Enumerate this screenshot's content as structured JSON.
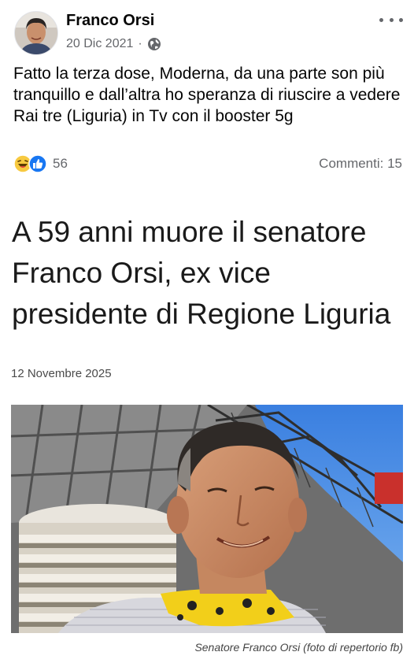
{
  "post": {
    "author": "Franco Orsi",
    "date": "20 Dic 2021",
    "separator": "·",
    "privacy_icon": "globe-icon",
    "more_icon": "more-options-icon",
    "text": "Fatto la terza dose, Moderna, da una parte son più tranquillo e dall’altra ho speranza di riuscire a vedere Rai tre (Liguria) in Tv con il booster 5g",
    "reactions": {
      "icons": [
        "laugh-reaction-icon",
        "like-reaction-icon"
      ],
      "count": "56"
    },
    "comments": "Commenti: 15"
  },
  "article": {
    "title": "A 59 anni muore il senatore Franco Orsi, ex vice presidente di Regione Liguria",
    "date": "12 Novembre 2025",
    "caption": "Senatore Franco Orsi (foto di repertorio fb)"
  },
  "colors": {
    "secondary_text": "#65676b",
    "like_blue": "#1877f2",
    "laugh_yellow": "#f7c940",
    "sky": "#4f8fe0"
  }
}
